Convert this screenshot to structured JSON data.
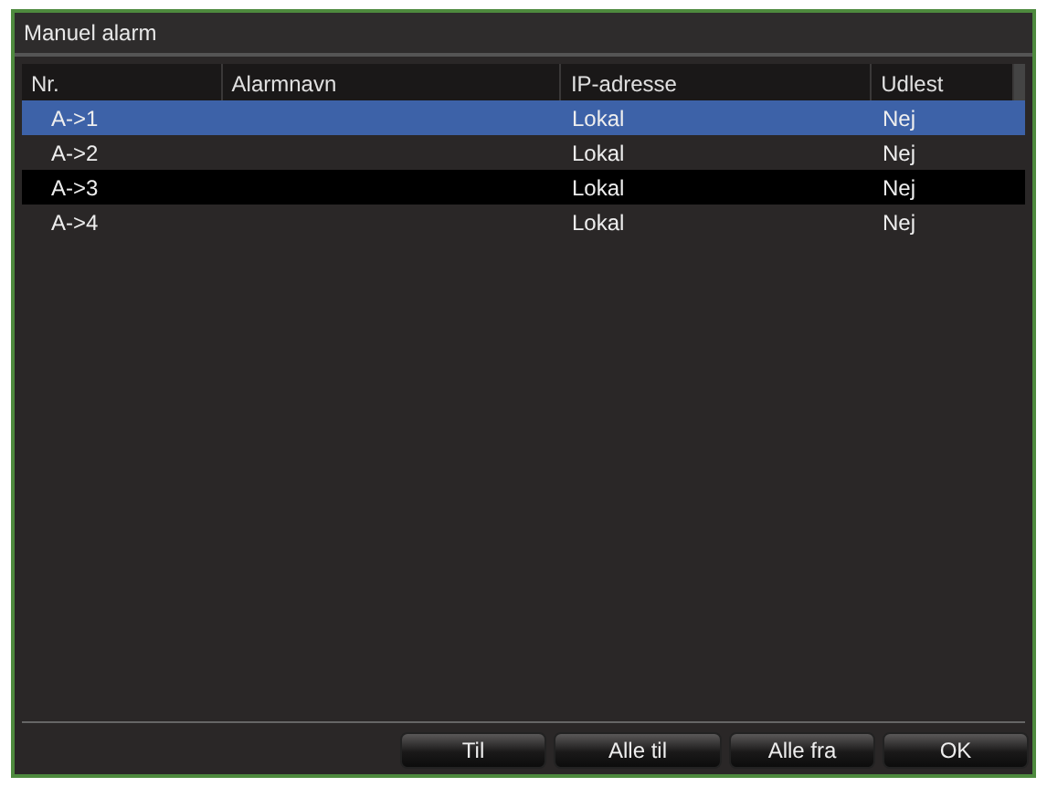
{
  "window": {
    "title": "Manuel alarm"
  },
  "table": {
    "columns": [
      "Nr.",
      "Alarmnavn",
      "IP-adresse",
      "Udlest"
    ],
    "rows": [
      {
        "cells": [
          "A->1",
          "",
          "Lokal",
          "Nej"
        ],
        "selected": true
      },
      {
        "cells": [
          "A->2",
          "",
          "Lokal",
          "Nej"
        ],
        "selected": false
      },
      {
        "cells": [
          "A->3",
          "",
          "Lokal",
          "Nej"
        ],
        "selected": false
      },
      {
        "cells": [
          "A->4",
          "",
          "Lokal",
          "Nej"
        ],
        "selected": false
      }
    ]
  },
  "buttons": [
    "Til",
    "Alle til",
    "Alle fra",
    "OK"
  ]
}
